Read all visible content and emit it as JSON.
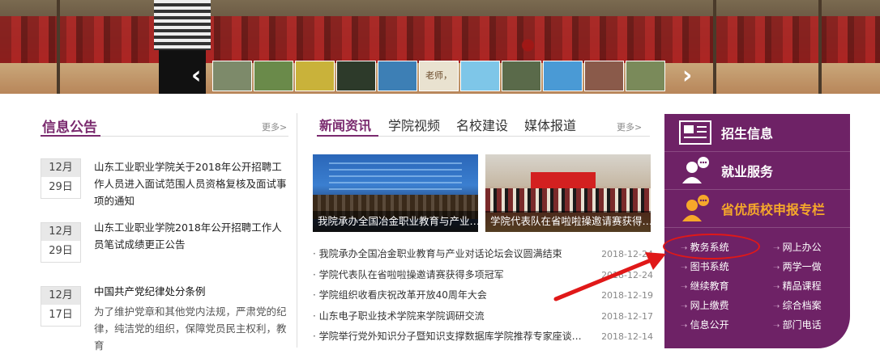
{
  "banner": {
    "prev_icon": "chevron-left-icon",
    "next_icon": "chevron-right-icon",
    "thumbnails": [
      {
        "color": "#7d8a6a",
        "text": ""
      },
      {
        "color": "#6a8a4a",
        "text": ""
      },
      {
        "color": "#c9b23a",
        "text": ""
      },
      {
        "color": "#2d3a2a",
        "text": ""
      },
      {
        "color": "#3d7fb5",
        "text": ""
      },
      {
        "color": "#e9e2d0",
        "text": "老师，"
      },
      {
        "color": "#7ec6e8",
        "text": ""
      },
      {
        "color": "#5a6a4a",
        "text": ""
      },
      {
        "color": "#4a9ad5",
        "text": ""
      },
      {
        "color": "#8a5a4a",
        "text": ""
      },
      {
        "color": "#7a8a5a",
        "text": ""
      }
    ]
  },
  "notices": {
    "title": "信息公告",
    "more": "更多>",
    "items": [
      {
        "month": "12月",
        "day": "29日",
        "text": "山东工业职业学院关于2018年公开招聘工作人员进入面试范围人员资格复核及面试事项的通知"
      },
      {
        "month": "12月",
        "day": "29日",
        "text": "山东工业职业学院2018年公开招聘工作人员笔试成绩更正公告"
      },
      {
        "month": "12月",
        "day": "17日",
        "title": "中国共产党纪律处分条例",
        "text": "为了维护党章和其他党内法规，严肃党的纪律，纯洁党的组织，保障党员民主权利，教育"
      }
    ]
  },
  "news": {
    "tabs": [
      "新闻资讯",
      "学院视频",
      "名校建设",
      "媒体报道"
    ],
    "more": "更多>",
    "featured": [
      {
        "caption": "我院承办全国冶金职业教育与产业…"
      },
      {
        "caption": "学院代表队在省啦啦操邀请赛获得…"
      }
    ],
    "list": [
      {
        "title": "我院承办全国冶金职业教育与产业对话论坛会议圆满结束",
        "date": "2018-12-24"
      },
      {
        "title": "学院代表队在省啦啦操邀请赛获得多项冠军",
        "date": "2018-12-24"
      },
      {
        "title": "学院组织收看庆祝改革开放40周年大会",
        "date": "2018-12-19"
      },
      {
        "title": "山东电子职业技术学院来学院调研交流",
        "date": "2018-12-17"
      },
      {
        "title": "学院举行党外知识分子暨知识支撑数据库学院推荐专家座谈…",
        "date": "2018-12-14"
      }
    ]
  },
  "sidebar": {
    "buttons": [
      {
        "label": "招生信息",
        "icon": "newspaper-icon"
      },
      {
        "label": "就业服务",
        "icon": "person-chat-icon"
      },
      {
        "label": "省优质校申报专栏",
        "icon": "person-chat-orange-icon"
      }
    ],
    "links": [
      "教务系统",
      "网上办公",
      "图书系统",
      "两学一做",
      "继续教育",
      "精品课程",
      "网上缴费",
      "综合档案",
      "信息公开",
      "部门电话"
    ],
    "highlight_color": "#f6a82a",
    "bg_color": "#6e2266"
  },
  "annotation": {
    "circle_color": "#e01818",
    "arrow_color": "#e01818"
  }
}
